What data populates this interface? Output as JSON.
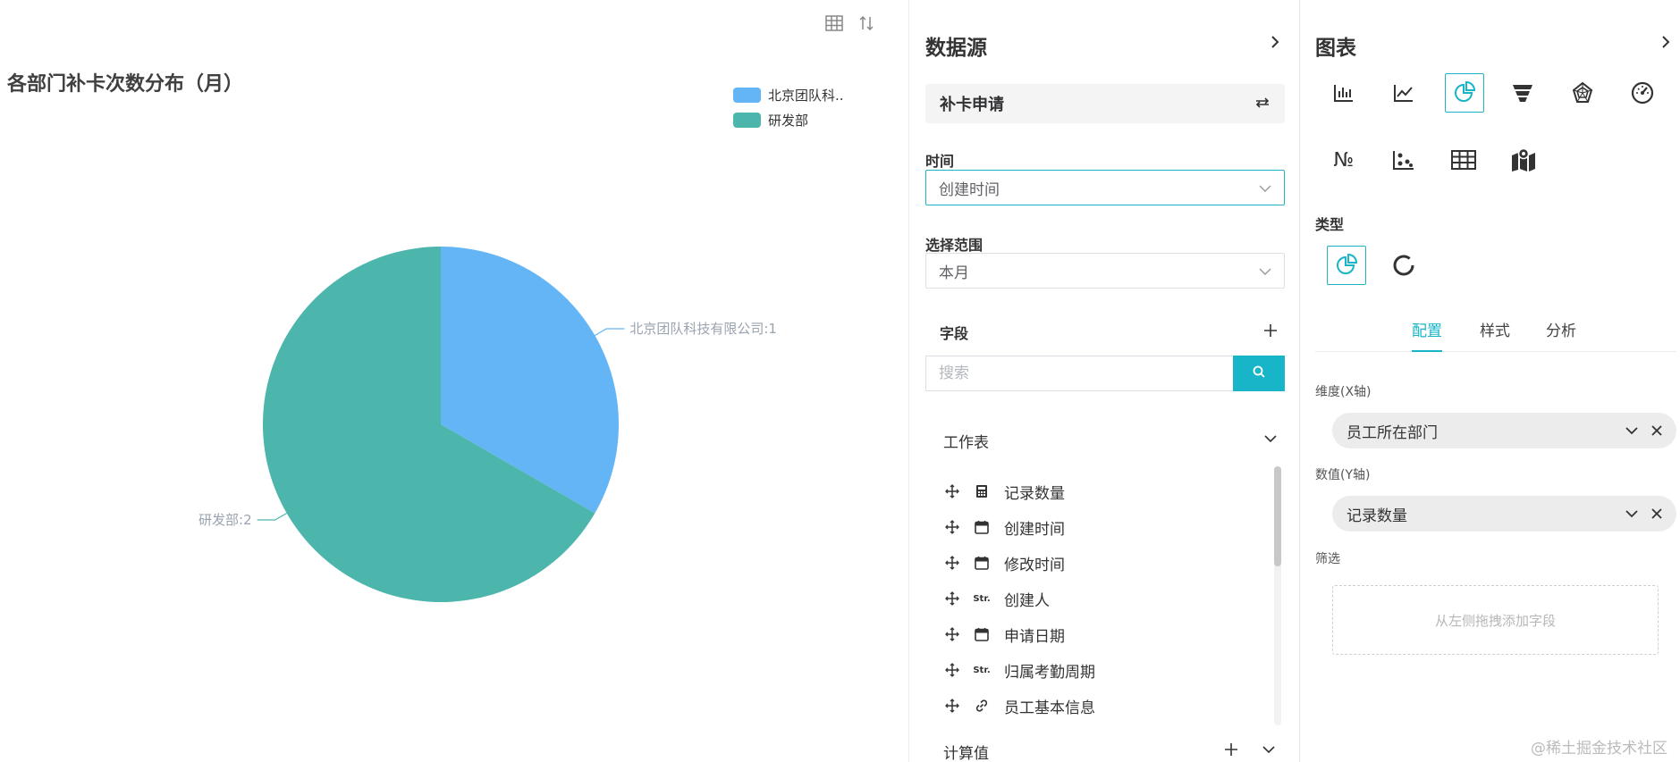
{
  "canvas": {
    "title": "各部门补卡次数分布（月）",
    "legend": [
      {
        "label": "北京团队科..",
        "color": "#64b5f6"
      },
      {
        "label": "研发部",
        "color": "#4db6ac"
      }
    ],
    "toolbar_icons": [
      "table-icon",
      "sort-icon"
    ]
  },
  "chart_data": {
    "type": "pie",
    "title": "各部门补卡次数分布（月）",
    "slices": [
      {
        "label": "北京团队科技有限公司",
        "value": 1,
        "color": "#64b5f6"
      },
      {
        "label": "研发部",
        "value": 2,
        "color": "#4db6ac"
      }
    ],
    "data_labels": [
      "北京团队科技有限公司:1",
      "研发部:2"
    ],
    "legend_position": "top-right"
  },
  "datasource": {
    "header": "数据源",
    "source_name": "补卡申请",
    "time_label": "时间",
    "time_value": "创建时间",
    "range_label": "选择范围",
    "range_value": "本月",
    "fields_label": "字段",
    "search_placeholder": "搜索",
    "group_worksheet": "工作表",
    "fields": [
      {
        "name": "记录数量",
        "type": "calc"
      },
      {
        "name": "创建时间",
        "type": "date"
      },
      {
        "name": "修改时间",
        "type": "date"
      },
      {
        "name": "创建人",
        "type": "str"
      },
      {
        "name": "申请日期",
        "type": "date"
      },
      {
        "name": "归属考勤周期",
        "type": "str"
      },
      {
        "name": "员工基本信息",
        "type": "link"
      }
    ],
    "str_badge": "Str.",
    "group_computed": "计算值"
  },
  "chartpanel": {
    "header": "图表",
    "chart_types": [
      "bar-chart-icon",
      "line-chart-icon",
      "pie-chart-icon",
      "funnel-chart-icon",
      "radar-chart-icon",
      "gauge-chart-icon",
      "number-card-icon",
      "scatter-chart-icon",
      "table-chart-icon",
      "map-chart-icon"
    ],
    "active_type": "pie-chart-icon",
    "number_glyph": "№",
    "type_label": "类型",
    "subtypes": [
      "pie-icon",
      "donut-icon"
    ],
    "tabs": [
      "配置",
      "样式",
      "分析"
    ],
    "active_tab": "配置",
    "dimension_label": "维度(X轴)",
    "dimension_value": "员工所在部门",
    "measure_label": "数值(Y轴)",
    "measure_value": "记录数量",
    "filter_label": "筛选",
    "filter_placeholder": "从左侧拖拽添加字段"
  },
  "watermark": "@稀土掘金技术社区",
  "colors": {
    "accent": "#18b5c8",
    "slice_blue": "#64b5f6",
    "slice_teal": "#4db6ac"
  }
}
